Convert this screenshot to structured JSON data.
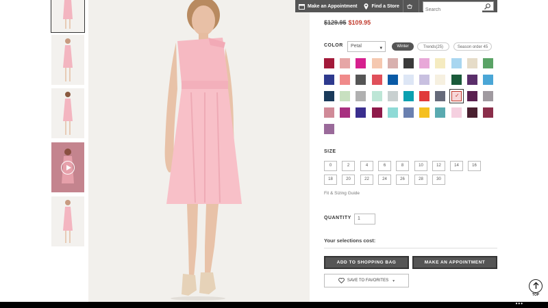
{
  "header": {
    "appointment_label": "Make an Appointment",
    "find_store_label": "Find a Store",
    "search_placeholder": "Search"
  },
  "product": {
    "old_price": "$129.95",
    "new_price": "$109.95"
  },
  "color": {
    "label": "COLOR",
    "selected": "Petal",
    "filters": [
      "Winter",
      "Trends(25)",
      "Season order 45"
    ],
    "swatches": [
      "#a31a3a",
      "#e6a6a6",
      "#d6208e",
      "#f5c8b0",
      "#d8b0ae",
      "#3a3a3a",
      "#e8a8d8",
      "#f5ebc0",
      "#a8d6f0",
      "#e6dcc8",
      "#5aa366",
      "#2e3a8e",
      "#f08a8a",
      "#555555",
      "#e0505a",
      "#0a5aa6",
      "#dde6f5",
      "#c8c0e0",
      "#f6f0e0",
      "#1a5a3a",
      "#5a2e6a",
      "#4aa6d6",
      "#1a3a5a",
      "#c8e0c0",
      "#b0b0b0",
      "#bde6d6",
      "#c8d0d0",
      "#0aa0b0",
      "#e03a3a",
      "#666a7a",
      "#f7d6d8",
      "#5a2050",
      "#a09aa0",
      "#d08a98",
      "#a83080",
      "#3a2e8e",
      "#8e1a4a",
      "#8edad6",
      "#6a80b0",
      "#f5c020",
      "#5aaab0",
      "#f5d0e0",
      "#4a2030",
      "#8a2e4a",
      "#9a6a9a"
    ]
  },
  "size": {
    "label": "SIZE",
    "options": [
      "0",
      "2",
      "4",
      "6",
      "8",
      "10",
      "12",
      "14",
      "16",
      "18",
      "20",
      "22",
      "24",
      "26",
      "28",
      "30"
    ],
    "fit_guide": "Fit & Sizing Guide"
  },
  "quantity": {
    "label": "QUANTITY",
    "value": "1"
  },
  "summary": {
    "cost_label": "Your selections cost:"
  },
  "actions": {
    "add_to_bag": "ADD TO SHOPPING BAG",
    "make_appointment": "MAKE AN APPOINTMENT",
    "save_favorites": "SAVE TO FAVORITES"
  },
  "nav": {
    "top_label": "TOP"
  }
}
